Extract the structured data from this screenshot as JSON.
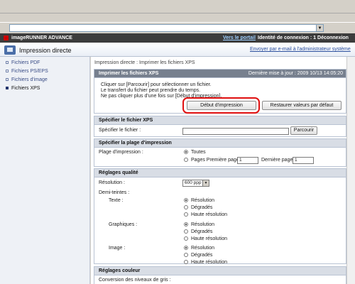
{
  "header": {
    "app_name": "imageRUNNER ADVANCE",
    "portal_link": "Vers le portail",
    "login_id": "Identité de connexion : 1 Déconnexion",
    "page_title": "Impression directe",
    "email_link": "Envoyer par e-mail à l'administrateur système"
  },
  "sidebar": {
    "items": [
      {
        "label": "Fichiers PDF"
      },
      {
        "label": "Fichiers PS/EPS"
      },
      {
        "label": "Fichiers d'image"
      },
      {
        "label": "Fichiers XPS"
      }
    ]
  },
  "breadcrumb": "Impression directe : Imprimer les fichiers XPS",
  "print_panel": {
    "title": "Imprimer les fichiers XPS",
    "last_update": "Dernière mise à jour : 2009 10/13 14:05:20",
    "info_line1": "Cliquer sur [Parcourir] pour sélectionner un fichier.",
    "info_line2": "Le transfert du fichier peut prendre du temps.",
    "info_line3": "Ne pas cliquer plus d'une fois sur [Début d'impression].",
    "start_button": "Début d'impression",
    "restore_button": "Restaurer valeurs par défaut"
  },
  "file_panel": {
    "title": "Spécifier le fichier XPS",
    "label": "Spécifier le fichier :",
    "browse_button": "Parcourir"
  },
  "range_panel": {
    "title": "Spécifier la plage d'impression",
    "label": "Plage d'impression :",
    "option_all": "Toutes",
    "option_pages": "Pages Première page :",
    "first_page_value": "1",
    "last_page_label": "Dernière page :",
    "last_page_value": "1"
  },
  "quality_panel": {
    "title": "Réglages qualité",
    "resolution_label": "Résolution :",
    "resolution_value": "600 ppp",
    "halftone_label": "Demi-teintes :",
    "groups": [
      {
        "name": "Texte :",
        "options": [
          "Résolution",
          "Dégradés",
          "Haute résolution"
        ],
        "selected": 0
      },
      {
        "name": "Graphiques :",
        "options": [
          "Résolution",
          "Dégradés",
          "Haute résolution"
        ],
        "selected": 0
      },
      {
        "name": "Image :",
        "options": [
          "Résolution",
          "Dégradés",
          "Haute résolution"
        ],
        "selected": 0
      }
    ]
  },
  "color_panel": {
    "title": "Réglages couleur",
    "gray_conversion_label": "Conversion des niveaux de gris :"
  },
  "colors": {
    "highlight": "#e01010",
    "header_bg": "#3c3c3c",
    "link": "#2b4f9e"
  }
}
